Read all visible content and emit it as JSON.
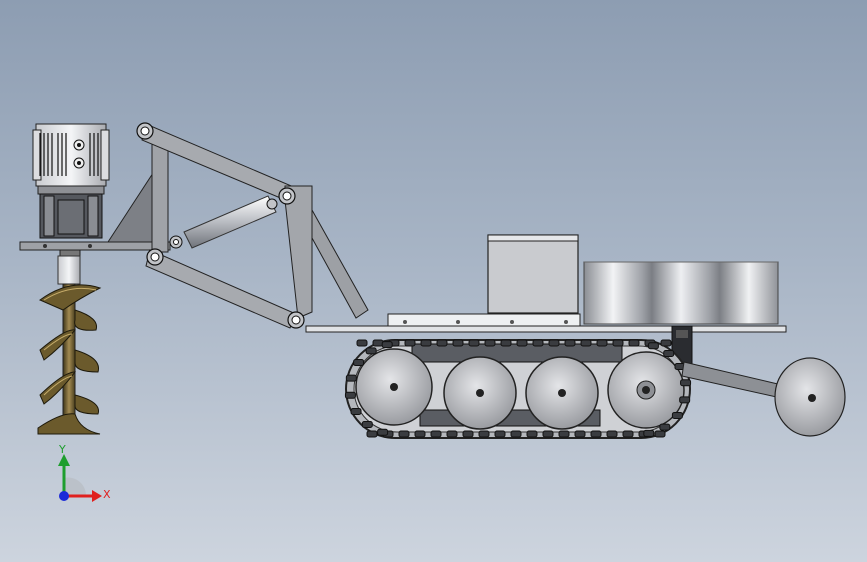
{
  "viewport": {
    "background_top": "#8d9db2",
    "background_bottom": "#cdd4de"
  },
  "model": {
    "parts": [
      "auger-motor",
      "auger-drill",
      "boom-arm",
      "hydraulic-cylinder",
      "control-box",
      "cable-drum",
      "crawler-track",
      "rear-disc-wheel"
    ]
  },
  "triad": {
    "x_label": "X",
    "y_label": "Y",
    "x_color": "#e0201e",
    "y_color": "#1e9e2e",
    "z_color": "#1a2ad8"
  }
}
